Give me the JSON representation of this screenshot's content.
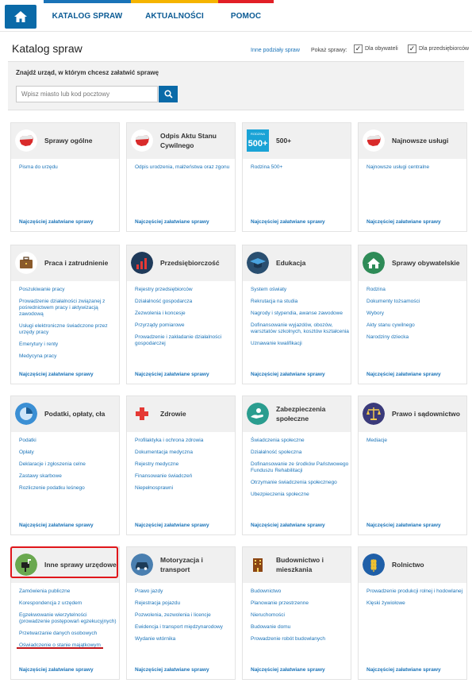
{
  "nav": {
    "tabs": [
      {
        "label": "KATALOG SPRAW",
        "color": "#1a73b8"
      },
      {
        "label": "AKTUALNOŚCI",
        "color": "#f5b400"
      },
      {
        "label": "POMOC",
        "color": "#e21f26"
      }
    ]
  },
  "page_title": "Katalog spraw",
  "toolbar": {
    "other_link": "Inne podziały spraw",
    "show_label": "Pokaż sprawy:",
    "citizens": "Dla obywateli",
    "business": "Dla przedsiębiorców"
  },
  "search": {
    "label": "Znajdź urząd, w którym chcesz załatwić sprawę",
    "placeholder": "Wpisz miasto lub kod pocztowy"
  },
  "footer_link": "Najczęściej załatwiane sprawy",
  "cards": [
    {
      "title": "Sprawy ogólne",
      "icon": "poland-map-icon",
      "items": [
        "Pisma do urzędu"
      ]
    },
    {
      "title": "Odpis Aktu Stanu Cywilnego",
      "icon": "poland-map-icon",
      "items": [
        "Odpis urodzenia, małżeństwa oraz zgonu"
      ]
    },
    {
      "title": "500+",
      "icon": "rodzina-500-icon",
      "icon_text": "500+",
      "icon_caption": "RODZINA",
      "items": [
        "Rodzina 500+"
      ]
    },
    {
      "title": "Najnowsze usługi",
      "icon": "poland-map-icon",
      "items": [
        "Najnowsze usługi centralne"
      ]
    },
    {
      "title": "Praca i zatrudnienie",
      "icon": "briefcase-icon",
      "items": [
        "Poszukiwanie pracy",
        "Prowadzenie działalności związanej z pośrednictwem pracy i aktywizacją zawodową",
        "Usługi elektroniczne świadczone przez urzędy pracy",
        "Emerytury i renty",
        "Medycyna pracy"
      ]
    },
    {
      "title": "Przedsiębiorczość",
      "icon": "bar-chart-icon",
      "items": [
        "Rejestry przedsiębiorców",
        "Działalność gospodarcza",
        "Zezwolenia i koncesje",
        "Przyrządy pomiarowe",
        "Prowadzenie i zakładanie działalności gospodarczej"
      ]
    },
    {
      "title": "Edukacja",
      "icon": "graduation-cap-icon",
      "items": [
        "System oświaty",
        "Rekrutacja na studia",
        "Nagrody i stypendia, awanse zawodowe",
        "Dofinansowanie wyjazdów, obozów, warsztatów szkolnych, kosztów kształcenia",
        "Uznawanie kwalifikacji"
      ]
    },
    {
      "title": "Sprawy obywatelskie",
      "icon": "house-icon",
      "items": [
        "Rodzina",
        "Dokumenty tożsamości",
        "Wybory",
        "Akty stanu cywilnego",
        "Narodziny dziecka"
      ]
    },
    {
      "title": "Podatki, opłaty, cła",
      "icon": "pie-chart-icon",
      "items": [
        "Podatki",
        "Opłaty",
        "Deklaracje i zgłoszenia celne",
        "Zastawy skarbowe",
        "Rozliczenie podatku leśnego"
      ]
    },
    {
      "title": "Zdrowie",
      "icon": "medical-cross-icon",
      "items": [
        "Profilaktyka i ochrona zdrowia",
        "Dokumentacja medyczna",
        "Rejestry medyczne",
        "Finansowanie świadczeń",
        "Niepełnosprawni"
      ]
    },
    {
      "title": "Zabezpieczenia społeczne",
      "icon": "helping-hand-icon",
      "items": [
        "Świadczenia społeczne",
        "Działalność społeczna",
        "Dofinansowanie ze środków Państwowego Funduszu Rehabilitacji",
        "Otrzymanie świadczenia społecznego",
        "Ubezpieczenia społeczne"
      ]
    },
    {
      "title": "Prawo i sądownictwo",
      "icon": "scales-icon",
      "items": [
        "Mediacje"
      ]
    },
    {
      "title": "Inne sprawy urzędowe",
      "icon": "mailbox-icon",
      "items": [
        "Zamówienia publiczne",
        "Korespondencja z urzędem",
        "Egzekwowanie wierzytelności (prowadzenie postępowań egzekucyjnych)",
        "Przetwarzanie danych osobowych",
        "Oświadczenie o stanie majątkowym"
      ]
    },
    {
      "title": "Motoryzacja i transport",
      "icon": "car-icon",
      "items": [
        "Prawo jazdy",
        "Rejestracja pojazdu",
        "Pozwolenia, zezwolenia i licencje",
        "Ewidencja i transport międzynarodowy",
        "Wydanie wtórnika"
      ]
    },
    {
      "title": "Budownictwo i mieszkania",
      "icon": "building-icon",
      "items": [
        "Budownictwo",
        "Planowanie przestrzenne",
        "Nieruchomości",
        "Budowanie domu",
        "Prowadzenie robót budowlanych"
      ]
    },
    {
      "title": "Rolnictwo",
      "icon": "wheat-icon",
      "items": [
        "Prowadzenie produkcji rolnej i hodowlanej",
        "Klęski żywiołowe"
      ]
    }
  ]
}
